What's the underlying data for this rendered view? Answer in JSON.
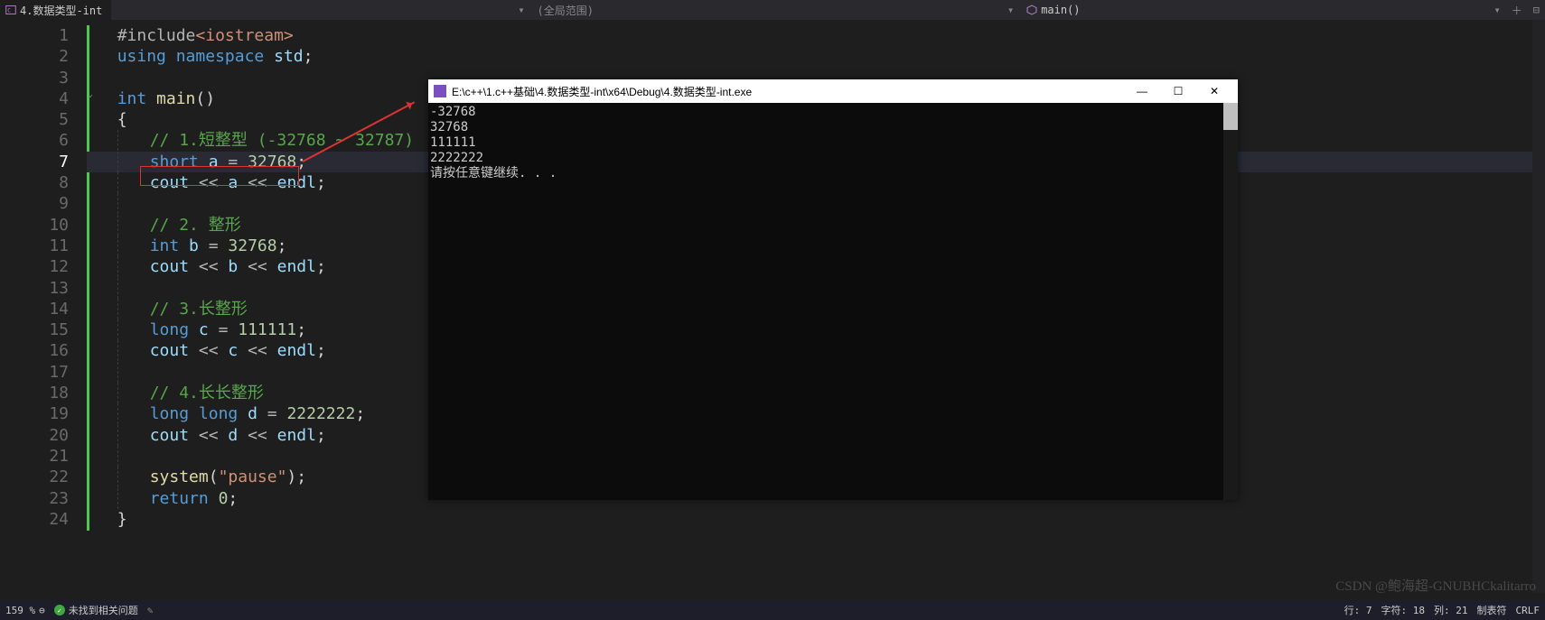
{
  "topbar": {
    "tabName": "4.数据类型-int",
    "scope": "(全局范围)",
    "func": "main()"
  },
  "gutter": [
    "1",
    "2",
    "3",
    "4",
    "5",
    "6",
    "7",
    "8",
    "9",
    "10",
    "11",
    "12",
    "13",
    "14",
    "15",
    "16",
    "17",
    "18",
    "19",
    "20",
    "21",
    "22",
    "23",
    "24"
  ],
  "code": {
    "l1": {
      "a": "#include",
      "b": "<iostream>"
    },
    "l2": {
      "a": "using",
      "b": "namespace",
      "c": "std",
      ";": ";"
    },
    "l4": {
      "a": "int",
      "b": "main",
      "c": "()"
    },
    "l5": "{",
    "l6": "// 1.短整型 (-32768 ~ 32787)",
    "l7": {
      "a": "short",
      "b": "a",
      "eq": " = ",
      "n": "32768",
      ";": ";"
    },
    "l8": {
      "a": "cout",
      "op1": " << ",
      "b": "a",
      "op2": " << ",
      "c": "endl",
      ";": ";"
    },
    "l10": "// 2. 整形",
    "l11": {
      "a": "int",
      "b": "b",
      "eq": " = ",
      "n": "32768",
      ";": ";"
    },
    "l12": {
      "a": "cout",
      "op1": " << ",
      "b": "b",
      "op2": " << ",
      "c": "endl",
      ";": ";"
    },
    "l14": "// 3.长整形",
    "l15": {
      "a": "long",
      "b": "c",
      "eq": " = ",
      "n": "111111",
      ";": ";"
    },
    "l16": {
      "a": "cout",
      "op1": " << ",
      "b": "c",
      "op2": " << ",
      "c": "endl",
      ";": ";"
    },
    "l18": "// 4.长长整形",
    "l19": {
      "a": "long",
      "a2": "long",
      "b": "d",
      "eq": " = ",
      "n": "2222222",
      ";": ";"
    },
    "l20": {
      "a": "cout",
      "op1": " << ",
      "b": "d",
      "op2": " << ",
      "c": "endl",
      ";": ";"
    },
    "l22": {
      "a": "system",
      "p": "(",
      "s": "\"pause\"",
      "p2": ")",
      ";": ";"
    },
    "l23": {
      "a": "return",
      "n": "0",
      ";": ";"
    },
    "l24": "}"
  },
  "console": {
    "title": "E:\\c++\\1.c++基础\\4.数据类型-int\\x64\\Debug\\4.数据类型-int.exe",
    "lines": [
      "-32768",
      "32768",
      "111111",
      "2222222",
      "请按任意键继续. . ."
    ]
  },
  "status": {
    "zoom": "159 %",
    "issues": "未找到相关问题",
    "line": "行: 7",
    "char": "字符: 18",
    "col": "列: 21",
    "tabs": "制表符",
    "eol": "CRLF"
  },
  "watermark": "CSDN @鲍海超-GNUBHCkalitarro"
}
